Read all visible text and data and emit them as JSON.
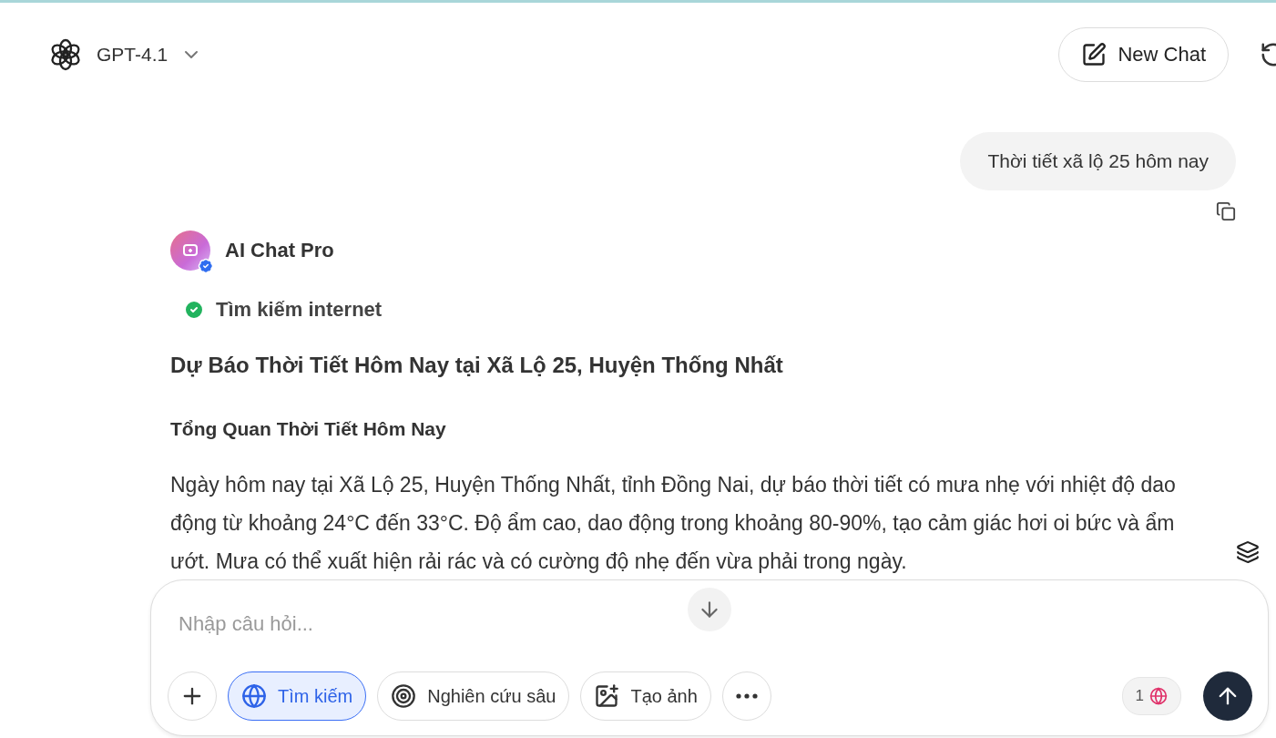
{
  "header": {
    "model": "GPT-4.1",
    "new_chat": "New Chat"
  },
  "user_message": {
    "text": "Thời tiết xã lộ 25 hôm nay"
  },
  "assistant": {
    "name": "AI Chat Pro",
    "verified": true,
    "step": {
      "label": "Tìm kiếm internet",
      "done": true
    },
    "title": "Dự Báo Thời Tiết Hôm Nay tại Xã Lộ 25, Huyện Thống Nhất",
    "subtitle": "Tổng Quan Thời Tiết Hôm Nay",
    "paragraph": "Ngày hôm nay tại Xã Lộ 25, Huyện Thống Nhất, tỉnh Đồng Nai, dự báo thời tiết có mưa nhẹ với nhiệt độ dao động từ khoảng 24°C đến 33°C. Độ ẩm cao, dao động trong khoảng 80-90%, tạo cảm giác hơi oi bức và ẩm ướt. Mưa có thể xuất hiện rải rác và có cường độ nhẹ đến vừa phải trong ngày."
  },
  "composer": {
    "placeholder": "Nhập câu hỏi...",
    "tools": [
      {
        "kind": "add",
        "selected": false
      },
      {
        "kind": "search",
        "label": "Tìm kiếm",
        "selected": true
      },
      {
        "kind": "research",
        "label": "Nghiên cứu sâu",
        "selected": false
      },
      {
        "kind": "image",
        "label": "Tạo ảnh",
        "selected": false
      },
      {
        "kind": "more",
        "selected": false
      }
    ],
    "sources_count": "1"
  }
}
